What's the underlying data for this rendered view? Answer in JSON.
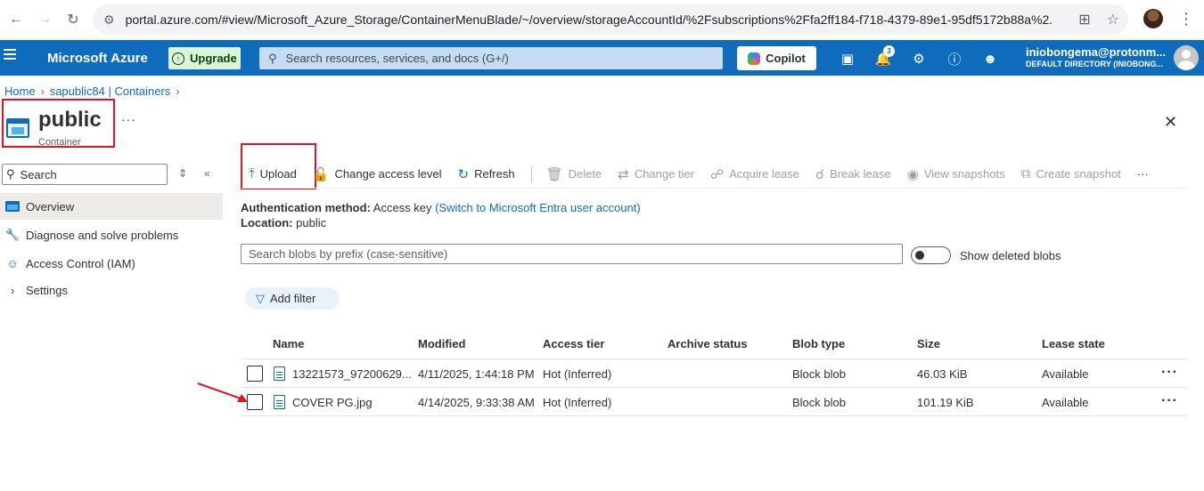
{
  "browser": {
    "url": "portal.azure.com/#view/Microsoft_Azure_Storage/ContainerMenuBlade/~/overview/storageAccountId/%2Fsubscriptions%2Ffa2ff184-f718-4379-89e1-95df5172b88a%2..."
  },
  "topbar": {
    "brand": "Microsoft Azure",
    "upgrade_label": "Upgrade",
    "search_placeholder": "Search resources, services, and docs (G+/)",
    "copilot_label": "Copilot",
    "notification_count": "3",
    "user_name": "iniobongema@protonm...",
    "user_directory": "DEFAULT DIRECTORY (INIOBONG..."
  },
  "breadcrumb": {
    "home": "Home",
    "parent": "sapublic84 | Containers"
  },
  "page": {
    "title": "public",
    "subtitle": "Container",
    "more": "···"
  },
  "sidebar": {
    "search_placeholder": "Search",
    "items": [
      {
        "label": "Overview"
      },
      {
        "label": "Diagnose and solve problems"
      },
      {
        "label": "Access Control (IAM)"
      },
      {
        "label": "Settings"
      }
    ]
  },
  "toolbar": {
    "upload": "Upload",
    "change_access_level": "Change access level",
    "refresh": "Refresh",
    "delete": "Delete",
    "change_tier": "Change tier",
    "acquire_lease": "Acquire lease",
    "break_lease": "Break lease",
    "view_snapshots": "View snapshots",
    "create_snapshot": "Create snapshot",
    "more": "···"
  },
  "info": {
    "auth_label": "Authentication method:",
    "auth_value": "Access key",
    "auth_link": "(Switch to Microsoft Entra user account)",
    "location_label": "Location:",
    "location_value": "public"
  },
  "filters": {
    "prefix_placeholder": "Search blobs by prefix (case-sensitive)",
    "show_deleted_label": "Show deleted blobs",
    "add_filter": "Add filter"
  },
  "table": {
    "headers": [
      "Name",
      "Modified",
      "Access tier",
      "Archive status",
      "Blob type",
      "Size",
      "Lease state"
    ],
    "rows": [
      {
        "name": "13221573_97200629...",
        "modified": "4/11/2025, 1:44:18 PM",
        "tier": "Hot (Inferred)",
        "archive": "",
        "type": "Block blob",
        "size": "46.03 KiB",
        "lease": "Available"
      },
      {
        "name": "COVER PG.jpg",
        "modified": "4/14/2025, 9:33:38 AM",
        "tier": "Hot (Inferred)",
        "archive": "",
        "type": "Block blob",
        "size": "101.19 KiB",
        "lease": "Available"
      }
    ],
    "row_more": "···"
  },
  "colors": {
    "azure_blue": "#0f6cbd",
    "annotation_red": "#e81123"
  }
}
